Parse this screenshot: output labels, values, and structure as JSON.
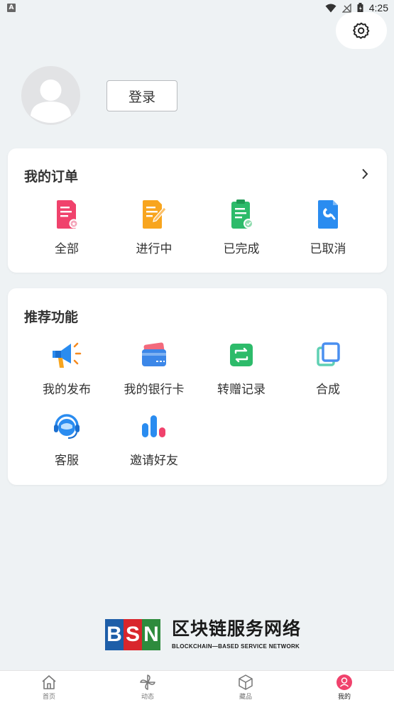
{
  "status_bar": {
    "time": "4:25",
    "app_badge": "A"
  },
  "profile": {
    "login_label": "登录"
  },
  "orders": {
    "title": "我的订单",
    "items": [
      {
        "label": "全部",
        "icon": "order-all-icon",
        "color": "#f0426c"
      },
      {
        "label": "进行中",
        "icon": "order-in-progress-icon",
        "color": "#f8a51e"
      },
      {
        "label": "已完成",
        "icon": "order-done-icon",
        "color": "#2dbb6a"
      },
      {
        "label": "已取消",
        "icon": "order-cancelled-icon",
        "color": "#2a8cf0"
      }
    ]
  },
  "features": {
    "title": "推荐功能",
    "items": [
      {
        "label": "我的发布",
        "icon": "megaphone-icon"
      },
      {
        "label": "我的银行卡",
        "icon": "bank-card-icon"
      },
      {
        "label": "转赠记录",
        "icon": "transfer-icon"
      },
      {
        "label": "合成",
        "icon": "compose-icon"
      },
      {
        "label": "客服",
        "icon": "customer-service-icon"
      },
      {
        "label": "邀请好友",
        "icon": "invite-friends-icon"
      }
    ]
  },
  "footer": {
    "logo_letters": [
      "B",
      "S",
      "N"
    ],
    "logo_colors": [
      "#1d5ea8",
      "#d9262c",
      "#2e8b3d"
    ],
    "title_cn": "区块链服务网络",
    "title_en": "BLOCKCHAIN—BASED SERVICE NETWORK"
  },
  "tabbar": {
    "tabs": [
      {
        "label": "首页",
        "icon": "home-icon"
      },
      {
        "label": "动态",
        "icon": "pinwheel-icon"
      },
      {
        "label": "藏品",
        "icon": "cube-icon"
      },
      {
        "label": "我的",
        "icon": "profile-icon",
        "active": true
      }
    ],
    "accent": "#f0426c"
  }
}
